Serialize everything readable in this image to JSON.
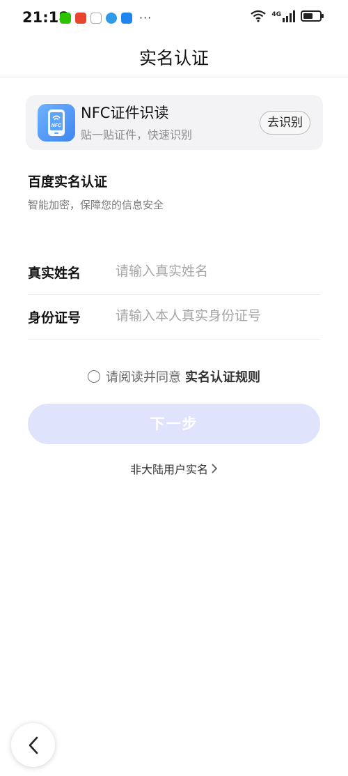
{
  "status_bar": {
    "time": "21:18",
    "network": "4G",
    "more": "···"
  },
  "header": {
    "title": "实名认证"
  },
  "nfc_card": {
    "icon_label": "NFC",
    "title": "NFC证件识读",
    "subtitle": "贴一贴证件，快速识别",
    "button_label": "去识别"
  },
  "section": {
    "title": "百度实名认证",
    "subtitle": "智能加密，保障您的信息安全"
  },
  "form": {
    "name_label": "真实姓名",
    "name_placeholder": "请输入真实姓名",
    "name_value": "",
    "id_label": "身份证号",
    "id_placeholder": "请输入本人真实身份证号",
    "id_value": ""
  },
  "agreement": {
    "prefix": "请阅读并同意",
    "link": "实名认证规则",
    "checked": false
  },
  "next_button_label": "下一步",
  "overseas_link": "非大陆用户实名",
  "colors": {
    "primary_disabled": "#dfe3fb",
    "card_bg": "#f3f3f5",
    "nfc_blue": "#3f86f0"
  }
}
